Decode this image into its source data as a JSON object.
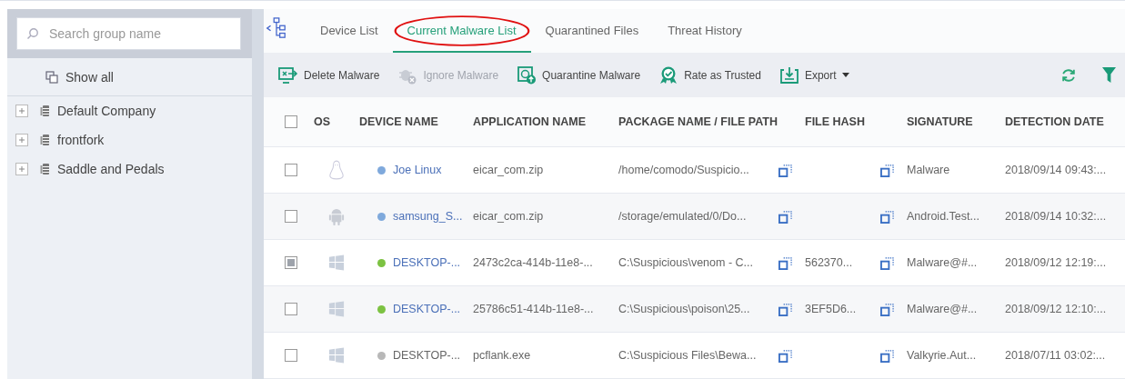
{
  "sidebar": {
    "search": {
      "placeholder": "Search group name"
    },
    "show_all": "Show all",
    "groups": [
      {
        "label": "Default Company",
        "expanded": false
      },
      {
        "label": "frontfork",
        "expanded": false
      },
      {
        "label": "Saddle and Pedals",
        "expanded": false
      }
    ]
  },
  "tabs": [
    {
      "label": "Device List",
      "selected": false,
      "circled": false
    },
    {
      "label": "Current Malware List",
      "selected": true,
      "circled": true
    },
    {
      "label": "Quarantined Files",
      "selected": false,
      "circled": false
    },
    {
      "label": "Threat History",
      "selected": false,
      "circled": false
    }
  ],
  "toolbar": [
    {
      "kind": "delete",
      "label": "Delete Malware",
      "disabled": false
    },
    {
      "kind": "ignore",
      "label": "Ignore Malware",
      "disabled": true
    },
    {
      "kind": "quarantine",
      "label": "Quarantine Malware",
      "disabled": false
    },
    {
      "kind": "trust",
      "label": "Rate as Trusted",
      "disabled": false
    },
    {
      "kind": "export",
      "label": "Export",
      "disabled": false
    }
  ],
  "table": {
    "all_checked": false,
    "columns": [
      "OS",
      "DEVICE NAME",
      "APPLICATION NAME",
      "PACKAGE NAME / FILE PATH",
      "FILE HASH",
      "SIGNATURE",
      "DETECTION DATE"
    ],
    "rows": [
      {
        "selected": false,
        "kind": "linux",
        "color": "#7fa9dc",
        "online": true,
        "device": "Joe Linux",
        "app": "eicar_com.zip",
        "path": "/home/comodo/Suspicio...",
        "hash": "",
        "signature": "Malware",
        "date": "2018/09/14 09:43:..."
      },
      {
        "selected": false,
        "kind": "android",
        "color": "#7fa9dc",
        "online": true,
        "device": "samsung_S...",
        "app": "eicar_com.zip",
        "path": "/storage/emulated/0/Do...",
        "hash": "",
        "signature": "Android.Test...",
        "date": "2018/09/14 10:32:..."
      },
      {
        "selected": true,
        "kind": "windows",
        "color": "#7cc242",
        "online": true,
        "device": "DESKTOP-...",
        "app": "2473c2ca-414b-11e8-...",
        "path": "C:\\Suspicious\\venom - C...",
        "hash": "562370...",
        "signature": "Malware@#...",
        "date": "2018/09/12 12:19:..."
      },
      {
        "selected": false,
        "kind": "windows",
        "color": "#7cc242",
        "online": true,
        "device": "DESKTOP-...",
        "app": "25786c51-414b-11e8-...",
        "path": "C:\\Suspicious\\poison\\25...",
        "hash": "3EF5D6...",
        "signature": "Malware@#...",
        "date": "2018/09/12 12:10:..."
      },
      {
        "selected": false,
        "kind": "windows",
        "color": "#b8b8b8",
        "online": false,
        "device": "DESKTOP-...",
        "app": "pcflank.exe",
        "path": "C:\\Suspicious Files\\Bewa...",
        "hash": "",
        "signature": "Valkyrie.Aut...",
        "date": "2018/07/11 03:02:..."
      }
    ]
  }
}
